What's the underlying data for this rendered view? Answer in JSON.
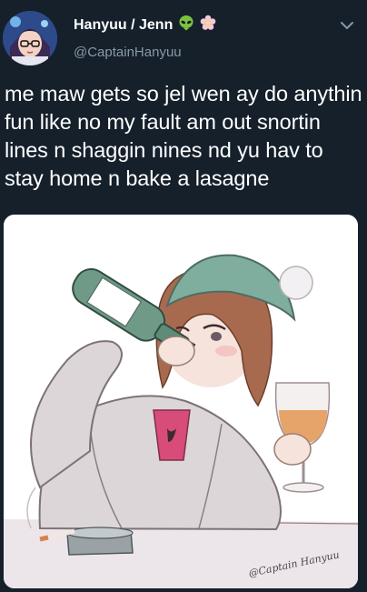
{
  "user": {
    "display_name": "Hanyuu / Jenn",
    "username": "@CaptainHanyuu",
    "name_icons": [
      "alien-icon",
      "flower-icon"
    ]
  },
  "tweet": {
    "text": "me maw gets so jel wen ay do anythin fun like no my fault am out snortin lines n shaggin nines nd yu hav to stay home n bake a lasagne"
  },
  "media": {
    "signature": "@Captain Hanyuu"
  },
  "colors": {
    "background": "#15202b",
    "secondary_text": "#8899a6",
    "alien_green": "#7cc241"
  }
}
